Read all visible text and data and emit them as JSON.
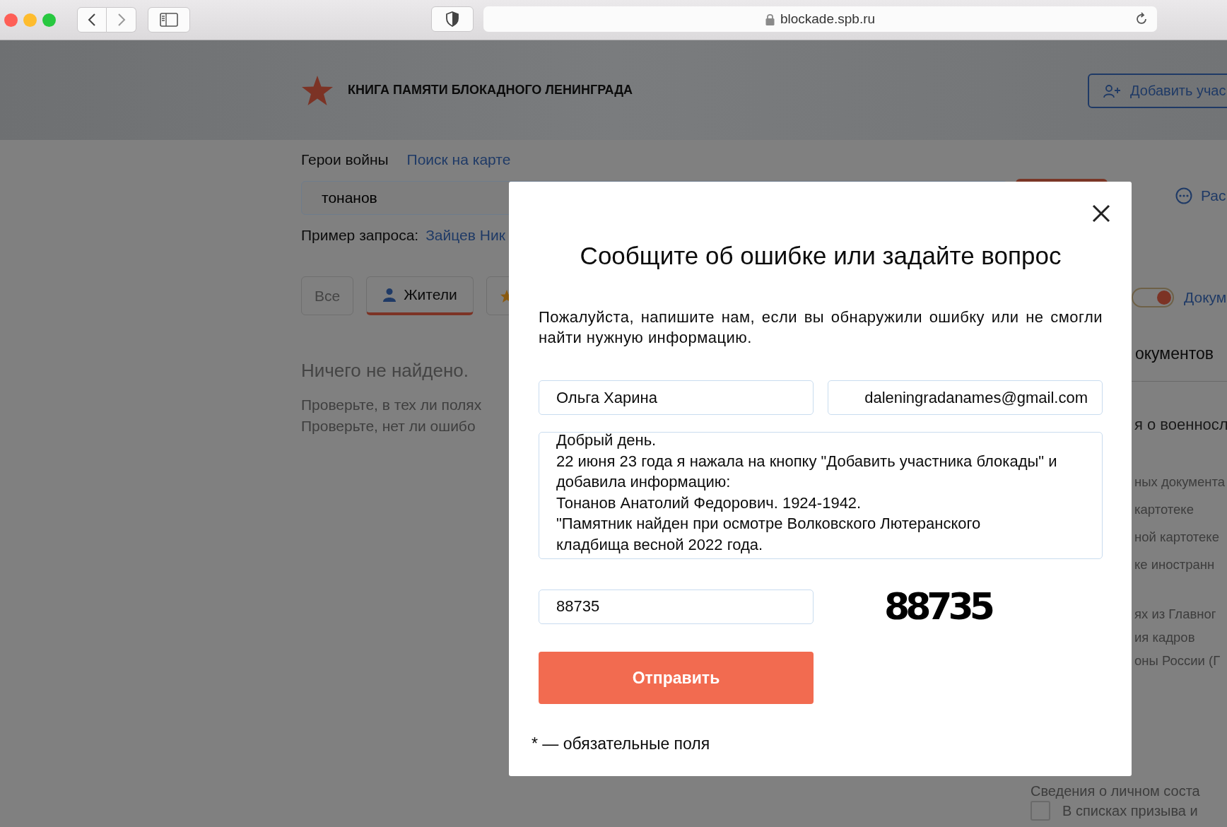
{
  "browser": {
    "url": "blockade.spb.ru"
  },
  "header": {
    "title": "КНИГА ПАМЯТИ БЛОКАДНОГО ЛЕНИНГРАДА",
    "add_button": "Добавить учас"
  },
  "nav": [
    {
      "label": "Герои войны",
      "kind": "text"
    },
    {
      "label": "Поиск на карте",
      "kind": "link"
    }
  ],
  "search": {
    "value": "тонанов"
  },
  "example": {
    "label": "Пример запроса:",
    "link": "Зайцев Ник"
  },
  "filter_tabs": [
    {
      "label": "Все",
      "selected": false
    },
    {
      "label": "Жители",
      "selected": true
    },
    {
      "selected": false
    }
  ],
  "results": {
    "title": "Ничего не найдено.",
    "hints": [
      "Проверьте, в тех ли полях",
      "Проверьте, нет ли ошибо"
    ]
  },
  "side": {
    "extended_search": "Рас",
    "documents_toggle": {
      "label": "Докум",
      "on": true
    },
    "heading": "окументов",
    "section": "я о военносл",
    "items": [
      "ных документа",
      "картотеке",
      "ной картотеке",
      "ке иностранн"
    ],
    "group": [
      "ях из Главног",
      "ия кадров",
      "оны России (Г"
    ],
    "personnel_heading": "Сведения о личном соста",
    "checkbox": {
      "label": "В списках призыва и",
      "checked": false
    }
  },
  "dialog": {
    "title": "Сообщите об ошибке или задайте вопрос",
    "intro": "Пожалуйста, напишите нам, если вы обнаружили ошибку или не смогли найти нужную информацию.",
    "name_field": {
      "value": "Ольга Харина"
    },
    "email_field": {
      "value": "daleningradanames@gmail.com"
    },
    "message_field": {
      "value": "Добрый день.\n22 июня 23 года я нажала на кнопку \"Добавить участника блокады\" и\nдобавила информацию:\nТонанов Анатолий Федорович. 1924-1942.\n\"Памятник найден при осмотре Волковского Лютеранского\nкладбища весной 2022 года."
    },
    "captcha_field": {
      "value": "88735"
    },
    "captcha_image": "88735",
    "submit": "Отправить",
    "footnote": "* — обязательные поля"
  }
}
